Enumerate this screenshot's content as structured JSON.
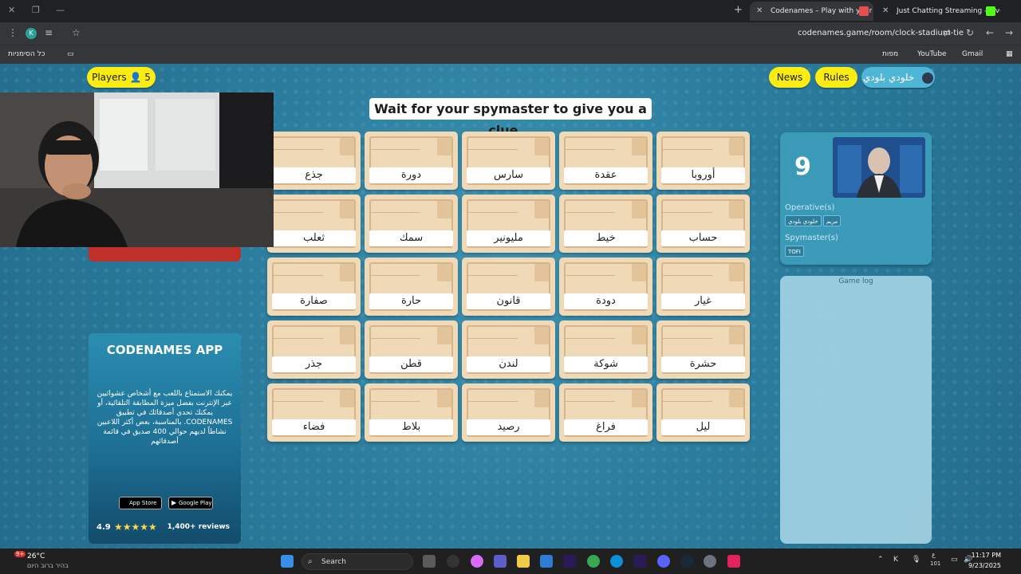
{
  "browser": {
    "tabs": [
      {
        "label": "Codenames – Play with your Fr"
      },
      {
        "label": "Just Chatting Streaming - Live"
      }
    ],
    "url": "codenames.game/room/clock-stadium-tie",
    "bookmarks": {
      "all_bookmarks": "כל הסימניות",
      "maps": "מפות",
      "youtube": "YouTube",
      "gmail": "Gmail"
    }
  },
  "game": {
    "players_label": "Players",
    "players_count": "5",
    "news_label": "News",
    "rules_label": "Rules",
    "username": "خلودي بلودي",
    "clue_message": "Wait for your spymaster to give you a clue...",
    "cards": [
      [
        "جذع",
        "دورة",
        "سارس",
        "عقدة",
        "أوروبا"
      ],
      [
        "ثعلب",
        "سمك",
        "مليونير",
        "خيط",
        "حساب"
      ],
      [
        "صفارة",
        "حارة",
        "قانون",
        "دودة",
        "غيار"
      ],
      [
        "جذر",
        "قطن",
        "لندن",
        "شوكة",
        "حشرة"
      ],
      [
        "فضاء",
        "بلاط",
        "رصيد",
        "فراغ",
        "ليل"
      ]
    ],
    "team": {
      "score": "9",
      "operatives_label": "Operative(s)",
      "operatives": [
        "خلودي بلودي",
        "مريم"
      ],
      "spymasters_label": "Spymaster(s)",
      "spymasters": [
        "TOFI"
      ]
    },
    "game_log_title": "Game log"
  },
  "promo": {
    "title": "CODENAMES APP",
    "text": "يمكنك الاستمتاع باللعب مع أشخاص عشوائيين عبر الإنترنت بفضل ميزة المطابقة التلقائية، أو يمكنك تحدي أصدقائك في تطبيق CODENAMES. بالمناسبة، بعض أكثر اللاعبين نشاطاً لديهم حوالي 400 صديق في قائمة أصدقائهم",
    "app_store": "App Store",
    "google_play": "Google Play",
    "rating": "4.9",
    "stars": "★★★★★",
    "reviews": "1,400+ reviews"
  },
  "taskbar": {
    "temperature": "26°C",
    "weather_desc": "בהיר ברוב היום",
    "notification_count": "9+",
    "search_placeholder": "Search",
    "time": "11:17 PM",
    "date": "9/23/2025",
    "lang_top": "ع",
    "lang_bottom": "101"
  },
  "colors": {
    "accent_yellow": "#fcec12",
    "card_beige": "#efd9b6",
    "team_blue": "#3c9ab9",
    "background": "#2b7d9e"
  }
}
